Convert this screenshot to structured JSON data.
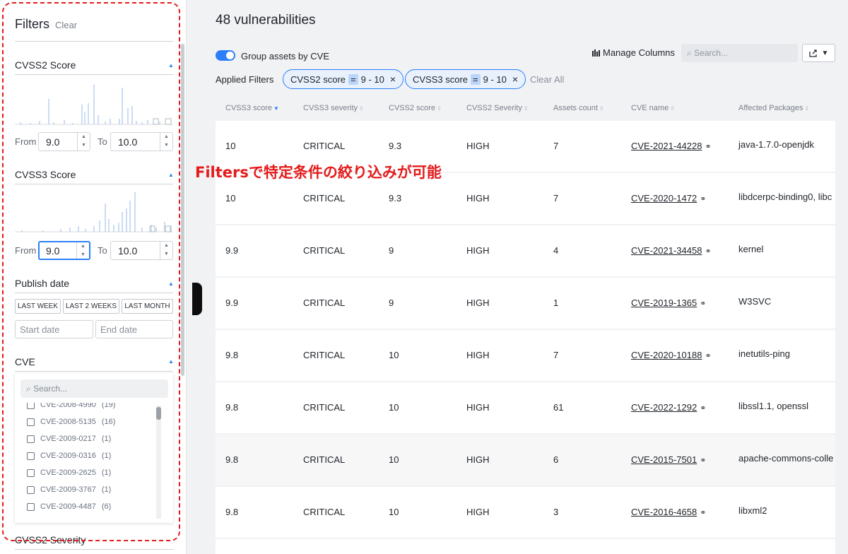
{
  "sidebar": {
    "title": "Filters",
    "clear": "Clear",
    "cvss2": {
      "title": "CVSS2 Score",
      "from_label": "From",
      "from_value": "9.0",
      "to_label": "To",
      "to_value": "10.0"
    },
    "cvss3": {
      "title": "CVSS3 Score",
      "from_label": "From",
      "from_value": "9.0",
      "to_label": "To",
      "to_value": "10.0"
    },
    "publish": {
      "title": "Publish date",
      "buttons": [
        "LAST WEEK",
        "LAST 2 WEEKS",
        "LAST MONTH"
      ],
      "start_placeholder": "Start date",
      "end_placeholder": "End date"
    },
    "cve": {
      "title": "CVE",
      "search_placeholder": "Search...",
      "items": [
        {
          "label": "CVE-2008-4990",
          "count": "(19)"
        },
        {
          "label": "CVE-2008-5135",
          "count": "(16)"
        },
        {
          "label": "CVE-2009-0217",
          "count": "(1)"
        },
        {
          "label": "CVE-2009-0316",
          "count": "(1)"
        },
        {
          "label": "CVE-2009-2625",
          "count": "(1)"
        },
        {
          "label": "CVE-2009-3767",
          "count": "(1)"
        },
        {
          "label": "CVE-2009-4487",
          "count": "(6)"
        }
      ]
    },
    "next_section": "CVSS2 Severity"
  },
  "annotation": "Filtersで特定条件の絞り込みが可能",
  "main": {
    "title": "48 vulnerabilities",
    "toggle_label": "Group assets by CVE",
    "manage_columns": "Manage Columns",
    "search_placeholder": "Search...",
    "applied_label": "Applied Filters",
    "chips": [
      {
        "name": "CVSS2 score",
        "eq": "=",
        "value": "9 - 10"
      },
      {
        "name": "CVSS3 score",
        "eq": "=",
        "value": "9 - 10"
      }
    ],
    "clear_all": "Clear All",
    "columns": [
      "CVSS3 score",
      "CVSS3 severity",
      "CVSS2 score",
      "CVSS2 Severity",
      "Assets count",
      "CVE name",
      "Affected Packages"
    ],
    "rows": [
      {
        "cvss3": "10",
        "sev3": "CRITICAL",
        "cvss2": "9.3",
        "sev2": "HIGH",
        "assets": "7",
        "cve": "CVE-2021-44228",
        "pkg": "java-1.7.0-openjdk"
      },
      {
        "cvss3": "10",
        "sev3": "CRITICAL",
        "cvss2": "9.3",
        "sev2": "HIGH",
        "assets": "7",
        "cve": "CVE-2020-1472",
        "pkg": "libdcerpc-binding0, libc"
      },
      {
        "cvss3": "9.9",
        "sev3": "CRITICAL",
        "cvss2": "9",
        "sev2": "HIGH",
        "assets": "4",
        "cve": "CVE-2021-34458",
        "pkg": "kernel"
      },
      {
        "cvss3": "9.9",
        "sev3": "CRITICAL",
        "cvss2": "9",
        "sev2": "HIGH",
        "assets": "1",
        "cve": "CVE-2019-1365",
        "pkg": "W3SVC"
      },
      {
        "cvss3": "9.8",
        "sev3": "CRITICAL",
        "cvss2": "10",
        "sev2": "HIGH",
        "assets": "7",
        "cve": "CVE-2020-10188",
        "pkg": "inetutils-ping"
      },
      {
        "cvss3": "9.8",
        "sev3": "CRITICAL",
        "cvss2": "10",
        "sev2": "HIGH",
        "assets": "61",
        "cve": "CVE-2022-1292",
        "pkg": "libssl1.1, openssl"
      },
      {
        "cvss3": "9.8",
        "sev3": "CRITICAL",
        "cvss2": "10",
        "sev2": "HIGH",
        "assets": "6",
        "cve": "CVE-2015-7501",
        "pkg": "apache-commons-colle"
      },
      {
        "cvss3": "9.8",
        "sev3": "CRITICAL",
        "cvss2": "10",
        "sev2": "HIGH",
        "assets": "3",
        "cve": "CVE-2016-4658",
        "pkg": "libxml2"
      }
    ]
  },
  "colors": {
    "accent": "#2d7ff9",
    "annotation": "#e31b1b"
  }
}
